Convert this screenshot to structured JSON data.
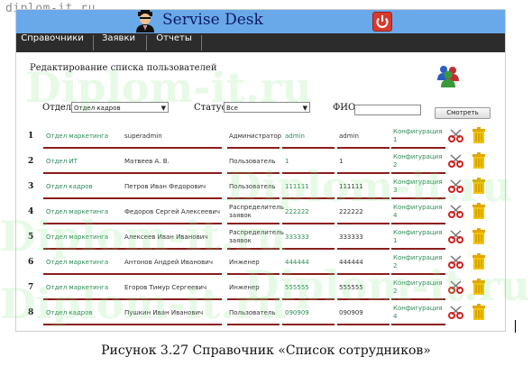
{
  "watermark_url": "diplom-it.ru",
  "watermark_big": "Diplom-it.ru",
  "header": {
    "title": "Servise Desk"
  },
  "nav": {
    "items": [
      "Справочники",
      "Заявки",
      "Отчеты"
    ]
  },
  "page_title": "Редактирование списка пользователей",
  "filters": {
    "dept_label": "Отдел",
    "dept_value": "Отдел кадров",
    "status_label": "Статус",
    "status_value": "Все",
    "fio_label": "ФИО",
    "fio_value": "",
    "search_button": "Смотреть"
  },
  "rows": [
    {
      "num": "1",
      "dept": "Отдел маркетинга",
      "name": "superadmin",
      "role": "Администратор",
      "login": "admin",
      "password": "admin",
      "config": "Конфигурация 1",
      "role_link": false
    },
    {
      "num": "2",
      "dept": "Отдел ИТ",
      "name": "Матвеев А. В.",
      "role": "Пользователь",
      "login": "1",
      "password": "1",
      "config": "Конфигурация 2",
      "role_link": false
    },
    {
      "num": "3",
      "dept": "Отдел кадров",
      "name": "Петров Иван Федорович",
      "role": "Пользователь",
      "login": "111111",
      "password": "111111",
      "config": "Конфигурация 3",
      "role_link": false
    },
    {
      "num": "4",
      "dept": "Отдел маркетинга",
      "name": "Федоров Сергей Алексеевич",
      "role": "Распределитель заявок",
      "login": "222222",
      "password": "222222",
      "config": "Конфигурация 4",
      "role_link": false
    },
    {
      "num": "5",
      "dept": "Отдел маркетинга",
      "name": "Алексеев Иван Иванович",
      "role": "Распределитель заявок",
      "login": "333333",
      "password": "333333",
      "config": "Конфигурация 1",
      "role_link": false
    },
    {
      "num": "6",
      "dept": "Отдел маркетинга",
      "name": "Антонов Андрей Иванович",
      "role": "Инженер",
      "login": "444444",
      "password": "444444",
      "config": "Конфигурация 2",
      "role_link": false
    },
    {
      "num": "7",
      "dept": "Отдел маркетинга",
      "name": "Егоров Тимур Сергеевич",
      "role": "Инженер",
      "login": "555555",
      "password": "555555",
      "config": "Конфигурация 2",
      "role_link": false
    },
    {
      "num": "8",
      "dept": "Отдел кадров",
      "name": "Пушкин Иван Иванович",
      "role": "Пользователь",
      "login": "090909",
      "password": "090909",
      "config": "Конфигурация 4",
      "role_link": false
    }
  ],
  "caption": "Рисунок 3.27 Справочник «Список сотрудников»",
  "colors": {
    "header": "#6aa9e9",
    "nav": "#2c2c2c",
    "row_line": "#8b1d1d",
    "link": "#2e8b57",
    "power": "#d83a2c"
  }
}
